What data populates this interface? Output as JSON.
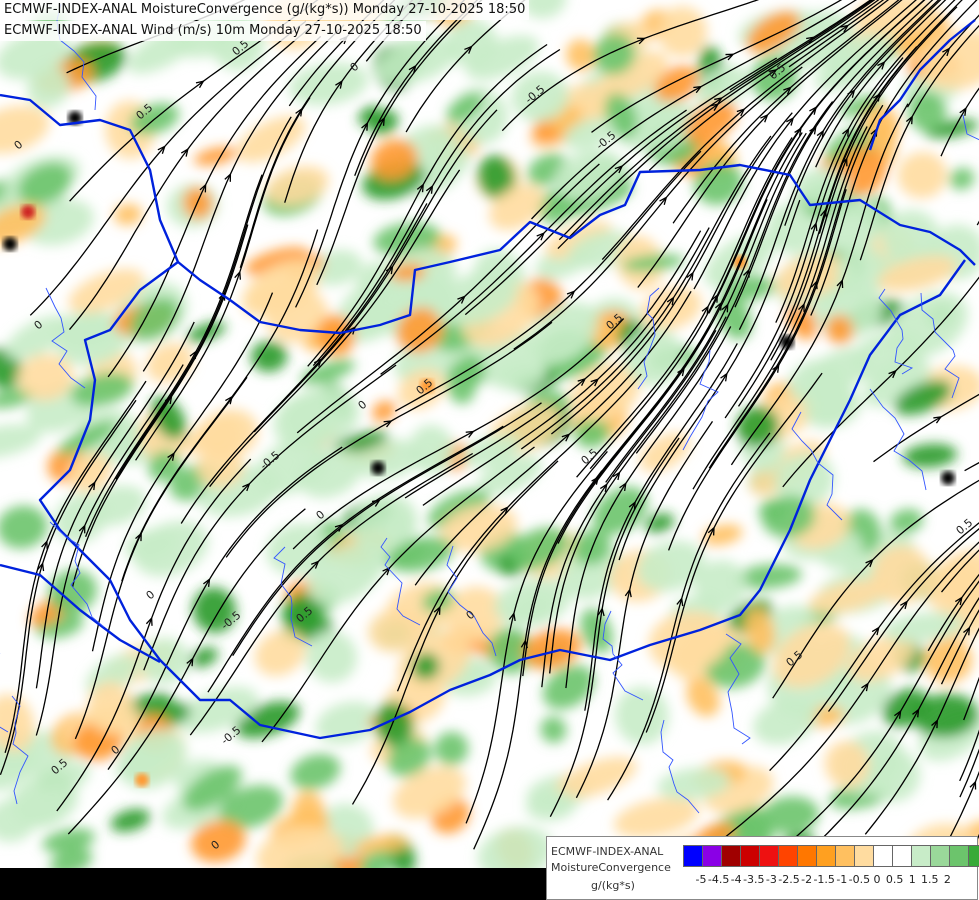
{
  "titles": {
    "line1": "ECMWF-INDEX-ANAL MoistureConvergence (g/(kg*s)) Monday 27-10-2025 18:50",
    "line2": "ECMWF-INDEX-ANAL Wind (m/s) 10m Monday 27-10-2025 18:50"
  },
  "legend": {
    "line1": "ECMWF-INDEX-ANAL",
    "line2": "MoistureConvergence",
    "units": "g/(kg*s)",
    "colors": [
      "#0000ff",
      "#8a00e6",
      "#a00000",
      "#cc0000",
      "#ee1111",
      "#ff4400",
      "#ff7700",
      "#ffa020",
      "#ffc060",
      "#ffdca0",
      "#ffffff",
      "#ffffff",
      "#c8ecc8",
      "#9ad89a",
      "#6cc46c",
      "#38aa38",
      "#009900"
    ],
    "ticks": [
      "-5",
      "-4.5",
      "-4",
      "-3.5",
      "-3",
      "-2.5",
      "-2",
      "-1.5",
      "-1",
      "-0.5",
      "0",
      "0.5",
      "1",
      "1.5",
      "2"
    ]
  },
  "map": {
    "contour_labels": [
      "0.5",
      "0",
      "-0.5",
      "0.5",
      "0",
      "0.5",
      "-0.5",
      "0",
      "0.5",
      "0",
      "0.5",
      "-0.5",
      "0",
      "0.5",
      "0",
      "-0.5",
      "0.5",
      "0",
      "0.5",
      "0",
      "-0.5",
      "0.5",
      "0",
      "0.5"
    ],
    "colors": {
      "border": "#0022dd",
      "river": "#3355ff",
      "streamline": "#000000",
      "convergence_light": "#c8ecc8",
      "convergence_mid": "#6cc46c",
      "convergence_dark": "#2a9a2a",
      "divergence_light": "#ffdca0",
      "divergence_mid": "#ffc060",
      "divergence_dark": "#ff9930"
    }
  }
}
